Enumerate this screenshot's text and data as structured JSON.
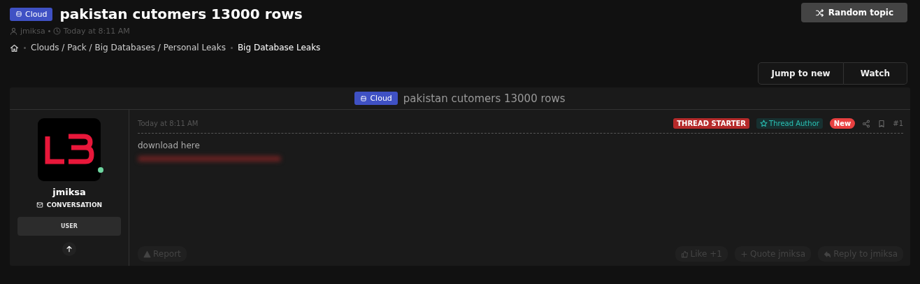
{
  "thread": {
    "prefix": "Cloud",
    "title": "pakistan cutomers 13000 rows",
    "author": "jmiksa",
    "time": "Today at 8:11 AM"
  },
  "random_button": "Random topic",
  "breadcrumb": [
    "Clouds / Pack / Big Databases / Personal Leaks",
    "Big Database Leaks"
  ],
  "actions": [
    "Jump to new",
    "Watch"
  ],
  "panel_header": {
    "prefix": "Cloud",
    "title": "pakistan cutomers 13000 rows"
  },
  "user": {
    "name": "jmiksa",
    "conversation": "CONVERSATION",
    "role": "USER",
    "online": true
  },
  "post": {
    "time": "Today at 8:11 AM",
    "badges": [
      {
        "label": "THREAD STARTER",
        "kind": "starter"
      },
      {
        "label": "Thread Author",
        "kind": "author"
      },
      {
        "label": "New",
        "kind": "new"
      }
    ],
    "number": "#1",
    "body": "download here"
  },
  "footer": {
    "report": "Report",
    "like": "Like +1",
    "quote": "Quote jmiksa",
    "reply": "Reply to jmiksa"
  }
}
